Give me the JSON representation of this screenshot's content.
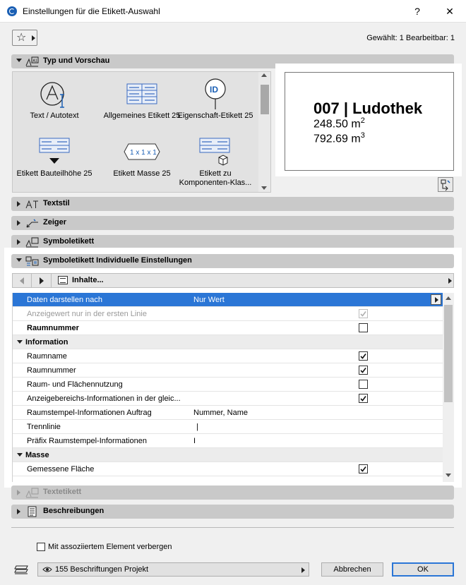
{
  "window": {
    "title": "Einstellungen für die Etikett-Auswahl",
    "help_label": "?",
    "close_label": "✕"
  },
  "toolbar": {
    "selection_info": "Gewählt: 1 Bearbeitbar: 1"
  },
  "sections": {
    "type_preview": "Typ und Vorschau",
    "text_style": "Textstil",
    "pointer": "Zeiger",
    "symbol_label": "Symboletikett",
    "symbol_individual": "Symboletikett Individuelle Einstellungen",
    "text_label": "Textetikett",
    "descriptions": "Beschreibungen"
  },
  "label_types": [
    {
      "label": "Text / Autotext",
      "icon": "text-autotext-icon"
    },
    {
      "label": "Allgemeines Etikett 25",
      "icon": "general-label-icon"
    },
    {
      "label": "Eigenschaft-Etikett 25",
      "icon": "property-label-icon"
    },
    {
      "label": "Etikett Bauteilhöhe 25",
      "icon": "element-height-label-icon"
    },
    {
      "label": "Etikett Masse 25",
      "icon": "dimension-label-icon"
    },
    {
      "label": "Etikett zu Komponenten-Klas...",
      "icon": "component-label-icon"
    }
  ],
  "type_icons": {
    "id_text": "ID",
    "dim_text": "1 x 1 x 1"
  },
  "preview": {
    "title": "007 | Ludothek",
    "area": "248.50 m",
    "area_exp": "2",
    "volume": "792.69 m",
    "volume_exp": "3"
  },
  "navigator": {
    "content_label": "Inhalte..."
  },
  "rows": [
    {
      "label": "Daten darstellen nach",
      "value": "Nur Wert"
    },
    {
      "label": "Anzeigewert nur in der ersten Linie"
    },
    {
      "label": "Raumnummer"
    },
    {
      "label": "Information"
    },
    {
      "label": "Raumname"
    },
    {
      "label": "Raumnummer"
    },
    {
      "label": "Raum- und Flächennutzung"
    },
    {
      "label": "Anzeigebereichs-Informationen in der gleic..."
    },
    {
      "label": "Raumstempel-Informationen Auftrag",
      "value": "Nummer, Name"
    },
    {
      "label": "Trennlinie",
      "value": "|"
    },
    {
      "label": "Präfix Raumstempel-Informationen",
      "value": "I"
    },
    {
      "label": "Masse"
    },
    {
      "label": "Gemessene Fläche"
    }
  ],
  "checkbox_states": {
    "first_line_only": true,
    "room_number_bold": false,
    "room_name": true,
    "room_number": true,
    "room_usage": false,
    "display_area_info": true,
    "measured_area": true
  },
  "footer": {
    "hide_with_element": "Mit assoziiertem Element verbergen",
    "project_selector": "155 Beschriftungen Projekt",
    "cancel": "Abbrechen",
    "ok": "OK"
  },
  "colors": {
    "selection": "#2b76d6",
    "accent": "#1a5fb4"
  }
}
